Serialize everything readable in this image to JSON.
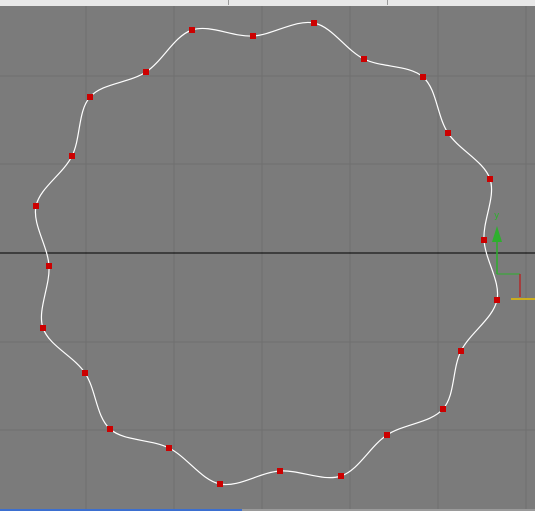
{
  "viewport": {
    "name": "top-viewport",
    "background_color": "#7b7b7b",
    "grid_color": "#6f6f6f",
    "home_grid_line_color": "#000000",
    "grid_visible": true
  },
  "spline": {
    "name": "circle-noise-spline",
    "stroke_color": "#ffffff",
    "vertex_color": "#cc0000",
    "vertex_count": 24
  },
  "gizmo": {
    "y_axis_label": "y",
    "y_axis_color": "#2db02d",
    "x_axis_color": "#cc0000",
    "aux_axis_color": "#e8c000"
  },
  "status_bar": {
    "accent_color": "#3b6fd0"
  }
}
